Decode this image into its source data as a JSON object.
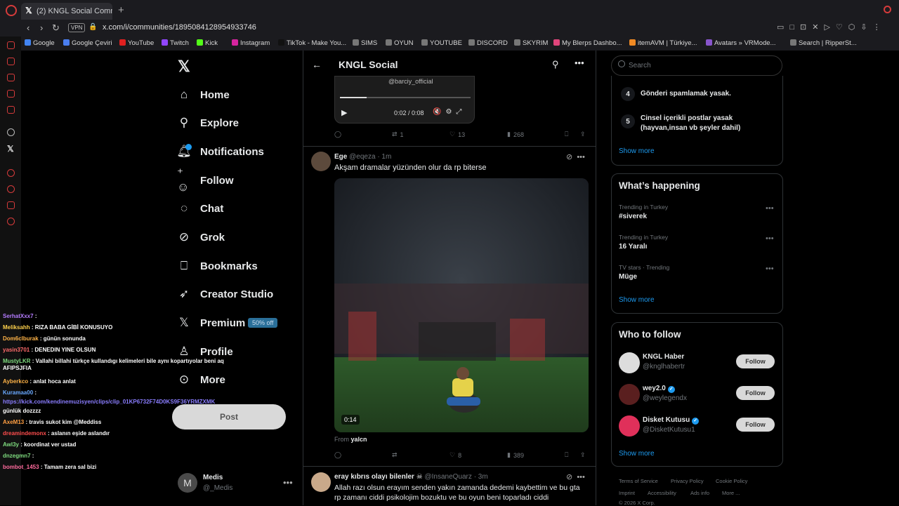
{
  "browser": {
    "tab_title": "(2) KNGL Social Communi",
    "url": "x.com/i/communities/1895084128954933746",
    "vpn_label": "VPN",
    "bookmarks": [
      {
        "label": "Google",
        "color": "#4285f4"
      },
      {
        "label": "Google Çeviri",
        "color": "#4a7ef0"
      },
      {
        "label": "YouTube",
        "color": "#e02020"
      },
      {
        "label": "Twitch",
        "color": "#9146ff"
      },
      {
        "label": "Kick",
        "color": "#53fc18"
      },
      {
        "label": "Instagram",
        "color": "#d6249f"
      },
      {
        "label": "TikTok - Make You...",
        "color": "#111111"
      },
      {
        "label": "SIMS",
        "color": "#777777"
      },
      {
        "label": "OYUN",
        "color": "#777777"
      },
      {
        "label": "YOUTUBE",
        "color": "#777777"
      },
      {
        "label": "DISCORD",
        "color": "#777777"
      },
      {
        "label": "SKYRIM",
        "color": "#777777"
      },
      {
        "label": "My Blerps Dashbo...",
        "color": "#e0457b"
      },
      {
        "label": "itemAVM | Türkiye...",
        "color": "#f08a24"
      },
      {
        "label": "Avatars » VRMode...",
        "color": "#8855cc"
      },
      {
        "label": "Search | RipperSt...",
        "color": "#777777"
      }
    ]
  },
  "nav": {
    "items": [
      {
        "label": "Home",
        "icon": "home-icon"
      },
      {
        "label": "Explore",
        "icon": "search-icon"
      },
      {
        "label": "Notifications",
        "icon": "bell-icon"
      },
      {
        "label": "Follow",
        "icon": "add-user-icon"
      },
      {
        "label": "Chat",
        "icon": "chat-icon"
      },
      {
        "label": "Grok",
        "icon": "grok-icon"
      },
      {
        "label": "Bookmarks",
        "icon": "bookmark-icon"
      },
      {
        "label": "Creator Studio",
        "icon": "rocket-icon"
      },
      {
        "label": "Premium",
        "icon": "x-logo-icon"
      },
      {
        "label": "Profile",
        "icon": "person-icon"
      },
      {
        "label": "More",
        "icon": "more-circle-icon"
      }
    ],
    "premium_tag": "50% off",
    "post_button": "Post",
    "me": {
      "initial": "M",
      "name": "Medis",
      "handle": "@_Medis"
    }
  },
  "chat_overlay": [
    {
      "user": "SerhatXxx7",
      "color": "#b57cff",
      "msg": ":"
    },
    {
      "user": "Meliksahh",
      "color": "#ffd24d",
      "msg": ": RIZA BABA GİBİ KONUSUYO"
    },
    {
      "user": "Dom6clburak",
      "color": "#ffb347",
      "msg": ": günün sonunda"
    },
    {
      "user": "yasin3701",
      "color": "#ff6b6b",
      "msg": ": DENEDIN YINE OLSUN"
    },
    {
      "user": "MustyLKR",
      "color": "#7fdc7f",
      "msg": ": Vallahi billahi türkçe kullandıgı kelimeleri bile aynı kopartıyolar beni aq"
    },
    {
      "user": "",
      "color": "#ffffff",
      "msg": "AFIPSJFIA"
    },
    {
      "user": "Ayberkco",
      "color": "#ffb347",
      "msg": ": anlat hoca anlat"
    },
    {
      "user": "Kuramaa00",
      "color": "#6aa9ff",
      "msg": ":"
    },
    {
      "user": "",
      "color": "#8a7dff",
      "msg": "https://kick.com/kendinemuzisyen/clips/clip_01KP6732F74D0KS9F36YRMZXMK"
    },
    {
      "user": "",
      "color": "#ffffff",
      "msg": "günlük dozzzz"
    },
    {
      "user": "AxeM13",
      "color": "#ff9f43",
      "msg": ": travis sukot kim @Meddiss"
    },
    {
      "user": "dreamindemonx",
      "color": "#ff4d4d",
      "msg": ": aslanın eşide aslandır"
    },
    {
      "user": "Awl3y",
      "color": "#7fdc7f",
      "msg": ": koordinat ver ustad"
    },
    {
      "user": "dnzegmn7",
      "color": "#7fdc7f",
      "msg": ":"
    },
    {
      "user": "bombot_1453",
      "color": "#ff6b9d",
      "msg": ": Tamam zera sal bizi"
    }
  ],
  "community": {
    "title": "KNGL Social"
  },
  "posts": [
    {
      "video_handle": "@barciy_official",
      "time": "0:02 / 0:08",
      "reposts": "1",
      "likes": "13",
      "views": "268"
    },
    {
      "name": "Ege",
      "handle": "@eqeza",
      "ago": "· 1m",
      "text": "Akşam dramalar yüzünden olur da rp biterse",
      "duration": "0:14",
      "from_label": "From",
      "from_user": "yalcn",
      "likes": "8",
      "views": "389"
    },
    {
      "name": "eray kıbrıs olayı bilenler",
      "handle": "@InsaneQuarz",
      "ago": "· 3m",
      "text": "Allah razı olsun erayım senden yakın zamanda dedemi kaybettim ve bu gta rp zamanı ciddi psikolojim bozuktu ve bu oyun beni toparladı ciddi"
    }
  ],
  "right": {
    "search_placeholder": "Search",
    "rules": [
      {
        "num": "4",
        "text": "Gönderi spamlamak yasak."
      },
      {
        "num": "5",
        "text": "Cinsel içerikli postlar yasak (hayvan,insan vb şeyler dahil)"
      }
    ],
    "show_more": "Show more",
    "happening_title": "What’s happening",
    "trends": [
      {
        "context": "Trending in Turkey",
        "topic": "#siverek"
      },
      {
        "context": "Trending in Turkey",
        "topic": "16 Yaralı"
      },
      {
        "context": "TV stars · Trending",
        "topic": "Müge"
      }
    ],
    "wtf_title": "Who to follow",
    "follow_label": "Follow",
    "suggestions": [
      {
        "name": "KNGL Haber",
        "handle": "@knglhabertr",
        "verified": false,
        "color": "#dddddd"
      },
      {
        "name": "wey2.0",
        "handle": "@weylegendx",
        "verified": true,
        "color": "#5a1f1f"
      },
      {
        "name": "Disket Kutusu",
        "handle": "@DisketKutusu1",
        "verified": true,
        "color": "#e0305a"
      }
    ],
    "footer": [
      "Terms of Service",
      "Privacy Policy",
      "Cookie Policy",
      "Imprint",
      "Accessibility",
      "Ads info",
      "More ...",
      "© 2026 X Corp."
    ]
  }
}
